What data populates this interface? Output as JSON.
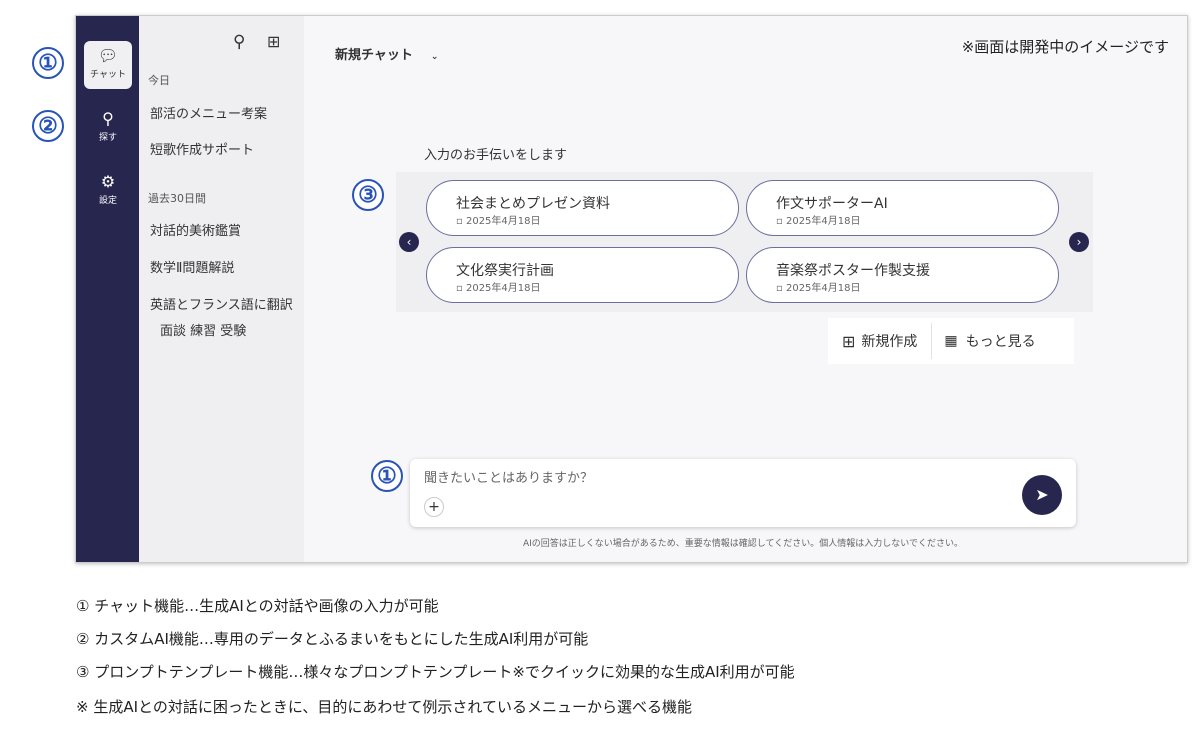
{
  "rail": {
    "items": [
      {
        "label": "チャット",
        "icon": "chat-icon"
      },
      {
        "label": "探す",
        "icon": "search-icon"
      },
      {
        "label": "設定",
        "icon": "gear-icon"
      }
    ]
  },
  "history": {
    "sections": [
      {
        "label": "今日",
        "items": [
          "部活のメニュー考案",
          "短歌作成サポート"
        ]
      },
      {
        "label": "過去30日間",
        "items": [
          "対話的美術鑑賞",
          "数学Ⅱ問題解説",
          "英語とフランス語に翻訳",
          "面談 練習 受験"
        ]
      }
    ]
  },
  "header": {
    "title": "新規チャット",
    "notice": "※画面は開発中のイメージです"
  },
  "templates": {
    "heading": "入力のお手伝いをします",
    "cards": [
      {
        "title": "社会まとめプレゼン資料",
        "date": "2025年4月18日"
      },
      {
        "title": "作文サポーターAI",
        "date": "2025年4月18日"
      },
      {
        "title": "文化祭実行計画",
        "date": "2025年4月18日"
      },
      {
        "title": "音楽祭ポスター作製支援",
        "date": "2025年4月18日"
      }
    ],
    "new_label": "新規作成",
    "more_label": "もっと見る"
  },
  "input": {
    "placeholder": "聞きたいことはありますか？",
    "disclaimer": "AIの回答は正しくない場合があるため、重要な情報は確認してください。個人情報は入力しないでください。"
  },
  "annotations": {
    "one": "①",
    "two": "②",
    "three": "③"
  },
  "notes": [
    "①  チャット機能…生成AIとの対話や画像の入力が可能",
    "②  カスタムAI機能…専用のデータとふるまいをもとにした生成AI利用が可能",
    "③  プロンプトテンプレート機能…様々なプロンプトテンプレート※でクイックに効果的な生成AI利用が可能",
    "※  生成AIとの対話に困ったときに、目的にあわせて例示されているメニューから選べる機能"
  ]
}
